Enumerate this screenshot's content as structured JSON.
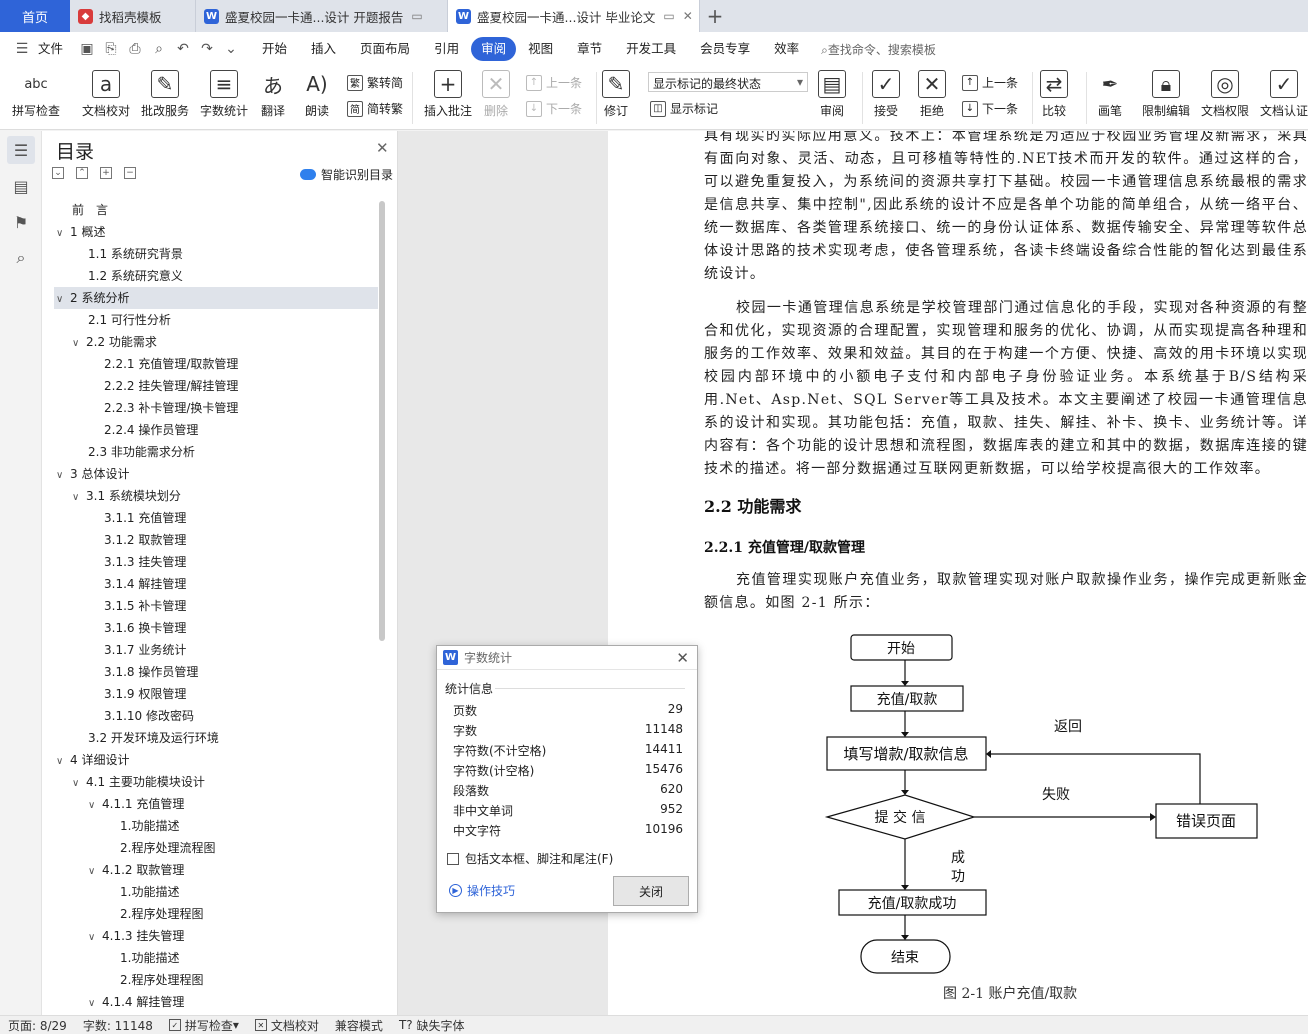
{
  "tabs": {
    "home": "首页",
    "items": [
      {
        "label": "找稻壳模板",
        "icon_color": "#d83b3b",
        "active": false
      },
      {
        "label": "盛夏校园一卡通...设计 开题报告",
        "icon_color": "#2f64d8",
        "active": false
      },
      {
        "label": "盛夏校园一卡通...设计 毕业论文",
        "icon_color": "#2f64d8",
        "active": true
      }
    ]
  },
  "menu": {
    "file": "文件",
    "items": [
      "开始",
      "插入",
      "页面布局",
      "引用",
      "审阅",
      "视图",
      "章节",
      "开发工具",
      "会员专享",
      "效率"
    ],
    "active": "审阅",
    "search": "查找命令、搜索模板"
  },
  "ribbon": {
    "spell": "拼写检查",
    "proof": "文档校对",
    "batch": "批改服务",
    "wordcount": "字数统计",
    "translate": "翻译",
    "read": "朗读",
    "trad": "繁转简",
    "simp": "简转繁",
    "insert_comment": "插入批注",
    "delete": "删除",
    "prev": "上一条",
    "next": "下一条",
    "revise": "修订",
    "markup_state": "显示标记的最终状态",
    "show_markup": "显示标记",
    "review": "审阅",
    "accept": "接受",
    "reject": "拒绝",
    "prev2": "上一条",
    "next2": "下一条",
    "compare": "比较",
    "pen": "画笔",
    "restrict": "限制编辑",
    "rights": "文档权限",
    "certify": "文档认证"
  },
  "toc": {
    "title": "目录",
    "smart": "智能识别目录",
    "items": [
      {
        "label": "前　言",
        "level": 0,
        "arrow": ""
      },
      {
        "label": "1  概述",
        "level": 0,
        "arrow": "v"
      },
      {
        "label": "1.1  系统研究背景",
        "level": 1,
        "arrow": ""
      },
      {
        "label": "1.2  系统研究意义",
        "level": 1,
        "arrow": ""
      },
      {
        "label": "2  系统分析",
        "level": 0,
        "arrow": "v",
        "selected": true
      },
      {
        "label": "2.1  可行性分析",
        "level": 1,
        "arrow": ""
      },
      {
        "label": "2.2  功能需求",
        "level": 1,
        "arrow": "v"
      },
      {
        "label": "2.2.1  充值管理/取款管理",
        "level": 2,
        "arrow": ""
      },
      {
        "label": "2.2.2  挂失管理/解挂管理",
        "level": 2,
        "arrow": ""
      },
      {
        "label": "2.2.3  补卡管理/换卡管理",
        "level": 2,
        "arrow": ""
      },
      {
        "label": "2.2.4  操作员管理",
        "level": 2,
        "arrow": ""
      },
      {
        "label": "2.3  非功能需求分析",
        "level": 1,
        "arrow": ""
      },
      {
        "label": "3  总体设计",
        "level": 0,
        "arrow": "v"
      },
      {
        "label": "3.1  系统模块划分",
        "level": 1,
        "arrow": "v"
      },
      {
        "label": "3.1.1  充值管理",
        "level": 2,
        "arrow": ""
      },
      {
        "label": "3.1.2  取款管理",
        "level": 2,
        "arrow": ""
      },
      {
        "label": "3.1.3  挂失管理",
        "level": 2,
        "arrow": ""
      },
      {
        "label": "3.1.4  解挂管理",
        "level": 2,
        "arrow": ""
      },
      {
        "label": "3.1.5  补卡管理",
        "level": 2,
        "arrow": ""
      },
      {
        "label": "3.1.6  换卡管理",
        "level": 2,
        "arrow": ""
      },
      {
        "label": "3.1.7  业务统计",
        "level": 2,
        "arrow": ""
      },
      {
        "label": "3.1.8  操作员管理",
        "level": 2,
        "arrow": ""
      },
      {
        "label": "3.1.9  权限管理",
        "level": 2,
        "arrow": ""
      },
      {
        "label": "3.1.10  修改密码",
        "level": 2,
        "arrow": ""
      },
      {
        "label": "3.2  开发环境及运行环境",
        "level": 1,
        "arrow": ""
      },
      {
        "label": "4  详细设计",
        "level": 0,
        "arrow": "v"
      },
      {
        "label": "4.1  主要功能模块设计",
        "level": 1,
        "arrow": "v"
      },
      {
        "label": "4.1.1  充值管理",
        "level": 2,
        "arrow": "v",
        "shift": true
      },
      {
        "label": "1.功能描述",
        "level": 3,
        "arrow": ""
      },
      {
        "label": "2.程序处理流程图",
        "level": 3,
        "arrow": ""
      },
      {
        "label": "4.1.2  取款管理",
        "level": 2,
        "arrow": "v",
        "shift": true
      },
      {
        "label": "1.功能描述",
        "level": 3,
        "arrow": ""
      },
      {
        "label": "2.程序处理程图",
        "level": 3,
        "arrow": ""
      },
      {
        "label": "4.1.3  挂失管理",
        "level": 2,
        "arrow": "v",
        "shift": true
      },
      {
        "label": "1.功能描述",
        "level": 3,
        "arrow": ""
      },
      {
        "label": "2.程序处理程图",
        "level": 3,
        "arrow": ""
      },
      {
        "label": "4.1.4  解挂管理",
        "level": 2,
        "arrow": "v",
        "shift": true
      }
    ]
  },
  "doc": {
    "para1": "具有现实的实际应用意义。技术上：本管理系统是为适应于校园业务管理及新需求，采具有面向对象、灵活、动态，且可移植等特性的.NET技术而开发的软件。通过这样的合，可以避免重复投入，为系统间的资源共享打下基础。校园一卡通管理信息系统最根的需求是信息共享、集中控制\",因此系统的设计不应是各单个功能的简单组合，从统一络平台、统一数据库、各类管理系统接口、统一的身份认证体系、数据传输安全、异常理等软件总体设计思路的技术实现考虑，使各管理系统，各读卡终端设备综合性能的智化达到最佳系统设计。",
    "para2": "校园一卡通管理信息系统是学校管理部门通过信息化的手段，实现对各种资源的有整合和优化，实现资源的合理配置，实现管理和服务的优化、协调，从而实现提高各种理和服务的工作效率、效果和效益。其目的在于构建一个方便、快捷、高效的用卡环境以实现校园内部环境中的小额电子支付和内部电子身份验证业务。本系统基于B/S结构采用.Net、Asp.Net、SQL Server等工具及技术。本文主要阐述了校园一卡通管理信息系的设计和实现。其功能包括：充值，取款、挂失、解挂、补卡、换卡、业务统计等。详内容有：各个功能的设计思想和流程图，数据库表的建立和其中的数据，数据库连接的键技术的描述。将一部分数据通过互联网更新数据，可以给学校提高很大的工作效率。",
    "h2": "2.2  功能需求",
    "h3": "2.2.1  充值管理/取款管理",
    "para3": "充值管理实现账户充值业务，取款管理实现对账户取款操作业务，操作完成更新账金额信息。如图 2-1 所示：",
    "caption": "图 2-1 账户充值/取款",
    "flow": {
      "start": "开始",
      "op": "充值/取款",
      "fill": "填写增款/取款信息",
      "submit": "提  交  信",
      "error": "错误页面",
      "success": "充值/取款成功",
      "end": "结束",
      "back": "返回",
      "fail": "失败",
      "ok1": "成",
      "ok2": "功"
    }
  },
  "dialog": {
    "title": "字数统计",
    "section": "统计信息",
    "stats": [
      {
        "label": "页数",
        "value": "29"
      },
      {
        "label": "字数",
        "value": "11148"
      },
      {
        "label": "字符数(不计空格)",
        "value": "14411"
      },
      {
        "label": "字符数(计空格)",
        "value": "15476"
      },
      {
        "label": "段落数",
        "value": "620"
      },
      {
        "label": "非中文单词",
        "value": "952"
      },
      {
        "label": "中文字符",
        "value": "10196"
      }
    ],
    "checkbox": "包括文本框、脚注和尾注(F)",
    "tips": "操作技巧",
    "close": "关闭"
  },
  "status": {
    "page": "页面: 8/29",
    "words": "字数: 11148",
    "spell": "拼写检查",
    "proof": "文档校对",
    "compat": "兼容模式",
    "missing_font": "缺失字体"
  }
}
